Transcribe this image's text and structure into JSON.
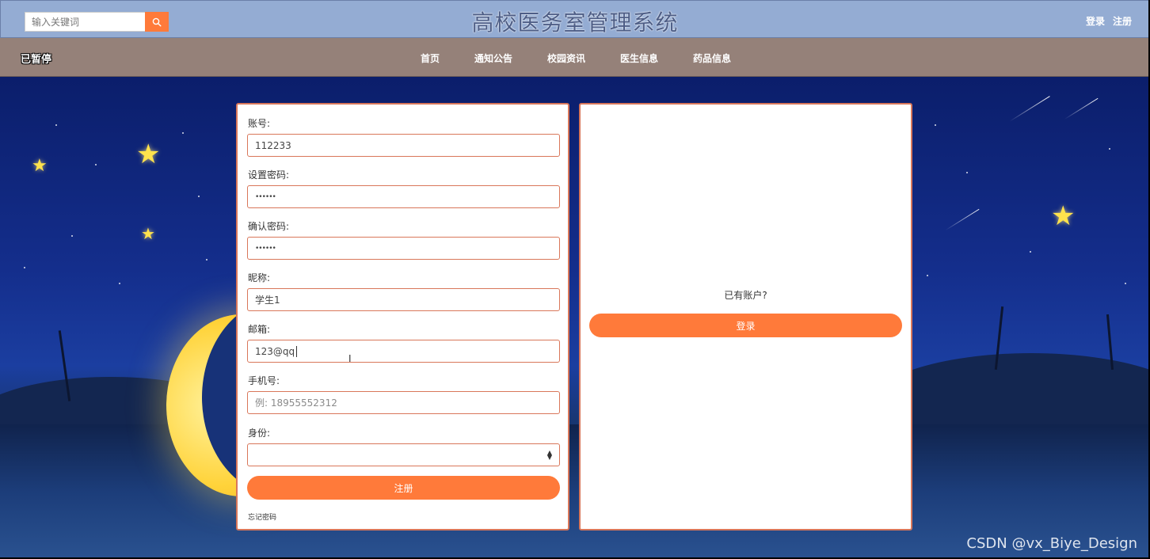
{
  "header": {
    "search_placeholder": "输入关键词",
    "site_title": "高校医务室管理系统",
    "login_link": "登录",
    "register_link": "注册"
  },
  "nav": {
    "status": "已暂停",
    "items": [
      "首页",
      "通知公告",
      "校园资讯",
      "医生信息",
      "药品信息"
    ]
  },
  "register_form": {
    "account_label": "账号:",
    "account_value": "112233",
    "password_label": "设置密码:",
    "password_value": "••••••",
    "confirm_label": "确认密码:",
    "confirm_value": "••••••",
    "nickname_label": "昵称:",
    "nickname_value": "学生1",
    "email_label": "邮箱:",
    "email_value": "123@qq",
    "phone_label": "手机号:",
    "phone_placeholder": "例: 18955552312",
    "identity_label": "身份:",
    "identity_value": "",
    "submit_label": "注册",
    "forgot_label": "忘记密码"
  },
  "login_panel": {
    "prompt": "已有账户?",
    "login_label": "登录"
  },
  "watermark": "CSDN @vx_Biye_Design",
  "colors": {
    "accent": "#ff7a3a",
    "header_bg": "#94acd3",
    "nav_bg": "#958179",
    "panel_border": "#d9775a"
  }
}
